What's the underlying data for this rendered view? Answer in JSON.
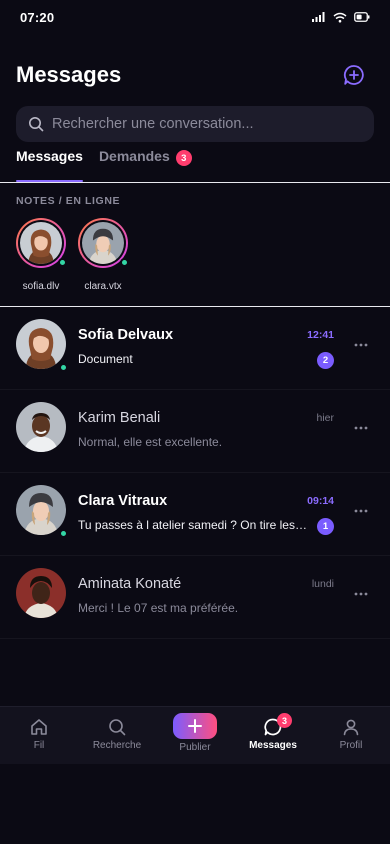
{
  "status_bar": {
    "time": "07:20"
  },
  "header": {
    "title": "Messages",
    "compose_icon": "message-plus-icon"
  },
  "search": {
    "placeholder": "Rechercher une conversation...",
    "icon": "search-icon"
  },
  "tabs": [
    {
      "label": "Messages",
      "active": true
    },
    {
      "label": "Demandes",
      "active": false,
      "badge": "3"
    }
  ],
  "notes": {
    "section_label": "NOTES / EN LIGNE",
    "items": [
      {
        "name": "sofia.dlv",
        "online": true
      },
      {
        "name": "clara.vtx",
        "online": true
      }
    ]
  },
  "conversations": [
    {
      "name": "Sofia Delvaux",
      "preview": "Document",
      "time": "12:41",
      "unread_count": "2",
      "unread": true,
      "online": true
    },
    {
      "name": "Karim Benali",
      "preview": "Normal, elle est excellente.",
      "time": "hier",
      "unread_count": null,
      "unread": false,
      "online": false
    },
    {
      "name": "Clara Vitraux",
      "preview": "Tu passes à l atelier samedi ? On tire les nouvelles photos",
      "time": "09:14",
      "unread_count": "1",
      "unread": true,
      "online": true
    },
    {
      "name": "Aminata Konaté",
      "preview": "Merci ! Le 07 est ma préférée.",
      "time": "lundi",
      "unread_count": null,
      "unread": false,
      "online": false
    }
  ],
  "bottom_nav": [
    {
      "label": "Fil",
      "icon": "home-icon"
    },
    {
      "label": "Recherche",
      "icon": "search-icon"
    },
    {
      "label": "Publier",
      "icon": "plus-icon"
    },
    {
      "label": "Messages",
      "icon": "chat-bubble-icon",
      "badge": "3",
      "active": true
    },
    {
      "label": "Profil",
      "icon": "user-icon"
    }
  ],
  "colors": {
    "background": "#0b0a14",
    "accent": "#8b6cff",
    "badge": "#ff3d6e",
    "online": "#33d6a5"
  }
}
